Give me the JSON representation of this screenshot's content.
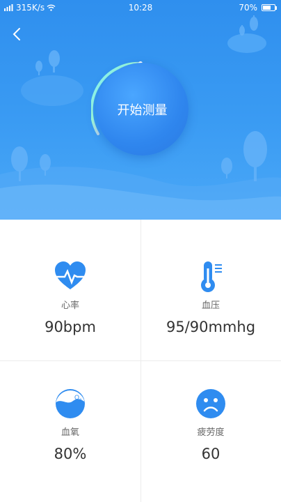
{
  "status_bar": {
    "network_speed": "315K/s",
    "time": "10:28",
    "battery_percent": "70%",
    "battery_level": 0.7
  },
  "header": {
    "back_icon": "chevron-left-icon",
    "measure_label": "开始测量",
    "colors": {
      "background": "#3a9bf3",
      "hill": "#5ab0f8"
    }
  },
  "metrics": [
    {
      "icon": "heart-rate-icon",
      "label": "心率",
      "value": "90bpm"
    },
    {
      "icon": "thermometer-icon",
      "label": "血压",
      "value": "95/90mmhg"
    },
    {
      "icon": "oxygen-icon",
      "label": "血氧",
      "value": "80%"
    },
    {
      "icon": "sad-face-icon",
      "label": "疲劳度",
      "value": "60"
    }
  ],
  "colors": {
    "icon_blue": "#2f8cf0",
    "text": "#333333",
    "label": "#666666"
  }
}
